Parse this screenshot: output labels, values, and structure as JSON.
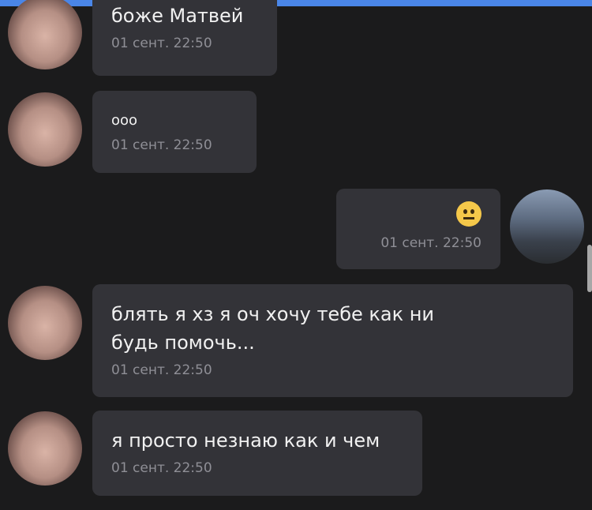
{
  "messages": [
    {
      "side": "left",
      "text": "боже Матвей",
      "time": "01 сент. 22:50"
    },
    {
      "side": "left",
      "text": "ооо",
      "time": "01 сент. 22:50"
    },
    {
      "side": "right",
      "emoji": "neutral-face",
      "time": "01 сент. 22:50"
    },
    {
      "side": "left",
      "text": "блять я хз я оч хочу тебе как ни\nбудь помочь...",
      "time": "01 сент. 22:50"
    },
    {
      "side": "left",
      "text": "я просто незнаю как и чем",
      "time": "01 сент. 22:50"
    }
  ],
  "colors": {
    "background": "#1b1b1c",
    "bubble": "#333338",
    "text": "#f1f1f1",
    "time": "#8f8f96",
    "accent": "#4a86e8"
  }
}
